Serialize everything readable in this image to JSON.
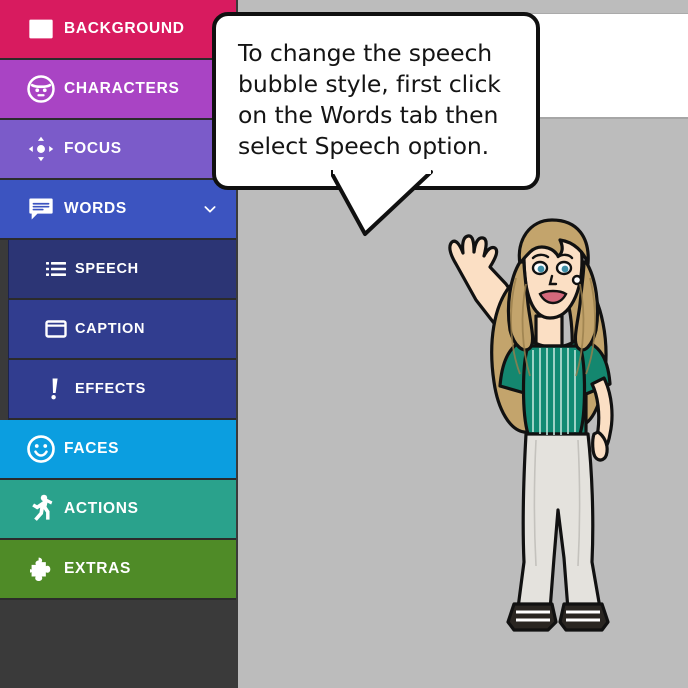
{
  "app": {
    "background_color": "#3a3a3a",
    "canvas_color": "#bcbcbc",
    "panel_color": "#ffffff"
  },
  "sidebar": {
    "items": [
      {
        "label": "BACKGROUND",
        "icon": "image-icon",
        "color": "#d81b5f",
        "level": "top",
        "selected": false,
        "expanded": false
      },
      {
        "label": "CHARACTERS",
        "icon": "face-icon",
        "color": "#a944c4",
        "level": "top",
        "selected": false,
        "expanded": false
      },
      {
        "label": "FOCUS",
        "icon": "move-icon",
        "color": "#7b5bc9",
        "level": "top",
        "selected": false,
        "expanded": false
      },
      {
        "label": "WORDS",
        "icon": "speech-bubble-icon",
        "color": "#3c54c0",
        "level": "top",
        "selected": false,
        "expanded": true
      },
      {
        "label": "SPEECH",
        "icon": "list-icon",
        "color": "#2c3575",
        "level": "sub",
        "selected": true,
        "expanded": false
      },
      {
        "label": "CAPTION",
        "icon": "window-icon",
        "color": "#313d8f",
        "level": "sub",
        "selected": false,
        "expanded": false
      },
      {
        "label": "EFFECTS",
        "icon": "exclamation-icon",
        "color": "#313d8f",
        "level": "sub",
        "selected": false,
        "expanded": false
      },
      {
        "label": "FACES",
        "icon": "smiley-icon",
        "color": "#0b9ee0",
        "level": "top",
        "selected": false,
        "expanded": false
      },
      {
        "label": "ACTIONS",
        "icon": "running-icon",
        "color": "#2aa28c",
        "level": "top",
        "selected": false,
        "expanded": false
      },
      {
        "label": "EXTRAS",
        "icon": "puzzle-icon",
        "color": "#4f8b27",
        "level": "top",
        "selected": false,
        "expanded": false
      }
    ],
    "expand_chevron": "chevron-down-icon"
  },
  "tooltip": {
    "text": "To change the speech bubble style, first click on the Words tab then select Speech option."
  },
  "character": {
    "description": "female-avatar-waving",
    "hair_color": "#c3a46c",
    "skin_color": "#fbdfc4",
    "top_color": "#14876f",
    "pants_color": "#e4e2dd",
    "shoe_color": "#231f20"
  }
}
